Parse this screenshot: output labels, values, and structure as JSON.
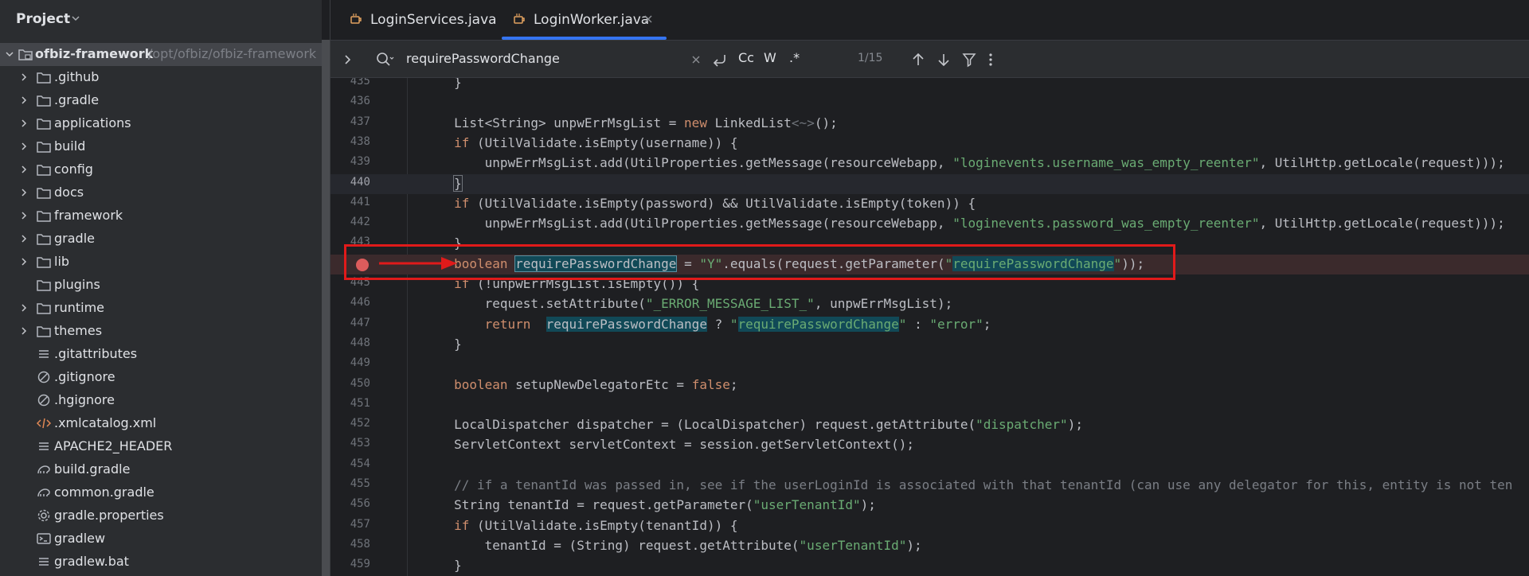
{
  "project": {
    "title": "Project",
    "root": {
      "name": "ofbiz-framework",
      "path": "/opt/ofbiz/ofbiz-framework"
    },
    "items": [
      {
        "label": ".github",
        "type": "folder",
        "expandable": true
      },
      {
        "label": ".gradle",
        "type": "folder",
        "expandable": true
      },
      {
        "label": "applications",
        "type": "folder",
        "expandable": true
      },
      {
        "label": "build",
        "type": "folder",
        "expandable": true
      },
      {
        "label": "config",
        "type": "folder",
        "expandable": true
      },
      {
        "label": "docs",
        "type": "folder",
        "expandable": true
      },
      {
        "label": "framework",
        "type": "folder",
        "expandable": true
      },
      {
        "label": "gradle",
        "type": "folder",
        "expandable": true
      },
      {
        "label": "lib",
        "type": "folder",
        "expandable": true
      },
      {
        "label": "plugins",
        "type": "folder",
        "expandable": false
      },
      {
        "label": "runtime",
        "type": "folder",
        "expandable": true
      },
      {
        "label": "themes",
        "type": "folder",
        "expandable": true
      },
      {
        "label": ".gitattributes",
        "type": "text"
      },
      {
        "label": ".gitignore",
        "type": "ignore"
      },
      {
        "label": ".hgignore",
        "type": "ignore"
      },
      {
        "label": ".xmlcatalog.xml",
        "type": "xml"
      },
      {
        "label": "APACHE2_HEADER",
        "type": "text"
      },
      {
        "label": "build.gradle",
        "type": "gradle"
      },
      {
        "label": "common.gradle",
        "type": "gradle"
      },
      {
        "label": "gradle.properties",
        "type": "gear"
      },
      {
        "label": "gradlew",
        "type": "terminal"
      },
      {
        "label": "gradlew.bat",
        "type": "text"
      }
    ]
  },
  "tabs": [
    {
      "label": "LoginServices.java",
      "active": false
    },
    {
      "label": "LoginWorker.java",
      "active": true
    }
  ],
  "search": {
    "query": "requirePasswordChange",
    "match_case": "Cc",
    "words": "W",
    "regex": ".*",
    "count": "1/15"
  },
  "editor": {
    "lines": [
      {
        "n": "435",
        "code": "        }"
      },
      {
        "n": "436",
        "code": ""
      },
      {
        "n": "437",
        "code": "        List<String> unpwErrMsgList = new LinkedList<~>();"
      },
      {
        "n": "438",
        "code": "        if (UtilValidate.isEmpty(username)) {"
      },
      {
        "n": "439",
        "code": "            unpwErrMsgList.add(UtilProperties.getMessage(resourceWebapp, \"loginevents.username_was_empty_reenter\", UtilHttp.getLocale(request)));"
      },
      {
        "n": "440",
        "code": "        }"
      },
      {
        "n": "441",
        "code": "        if (UtilValidate.isEmpty(password) && UtilValidate.isEmpty(token)) {"
      },
      {
        "n": "442",
        "code": "            unpwErrMsgList.add(UtilProperties.getMessage(resourceWebapp, \"loginevents.password_was_empty_reenter\", UtilHttp.getLocale(request)));"
      },
      {
        "n": "443",
        "code": "        }"
      },
      {
        "n": "",
        "code": "        boolean requirePasswordChange = \"Y\".equals(request.getParameter(\"requirePasswordChange\"));"
      },
      {
        "n": "445",
        "code": "        if (!unpwErrMsgList.isEmpty()) {"
      },
      {
        "n": "446",
        "code": "            request.setAttribute(\"_ERROR_MESSAGE_LIST_\", unpwErrMsgList);"
      },
      {
        "n": "447",
        "code": "            return  requirePasswordChange ? \"requirePasswordChange\" : \"error\";"
      },
      {
        "n": "448",
        "code": "        }"
      },
      {
        "n": "449",
        "code": ""
      },
      {
        "n": "450",
        "code": "        boolean setupNewDelegatorEtc = false;"
      },
      {
        "n": "451",
        "code": ""
      },
      {
        "n": "452",
        "code": "        LocalDispatcher dispatcher = (LocalDispatcher) request.getAttribute(\"dispatcher\");"
      },
      {
        "n": "453",
        "code": "        ServletContext servletContext = session.getServletContext();"
      },
      {
        "n": "454",
        "code": ""
      },
      {
        "n": "455",
        "code": "        // if a tenantId was passed in, see if the userLoginId is associated with that tenantId (can use any delegator for this, entity is not ten"
      },
      {
        "n": "456",
        "code": "        String tenantId = request.getParameter(\"userTenantId\");"
      },
      {
        "n": "457",
        "code": "        if (UtilValidate.isEmpty(tenantId)) {"
      },
      {
        "n": "458",
        "code": "            tenantId = (String) request.getAttribute(\"userTenantId\");"
      },
      {
        "n": "459",
        "code": "        }"
      }
    ]
  },
  "colors": {
    "accent": "#3574f0",
    "breakpoint": "#db5c5c",
    "annotation": "#e11a1a"
  }
}
